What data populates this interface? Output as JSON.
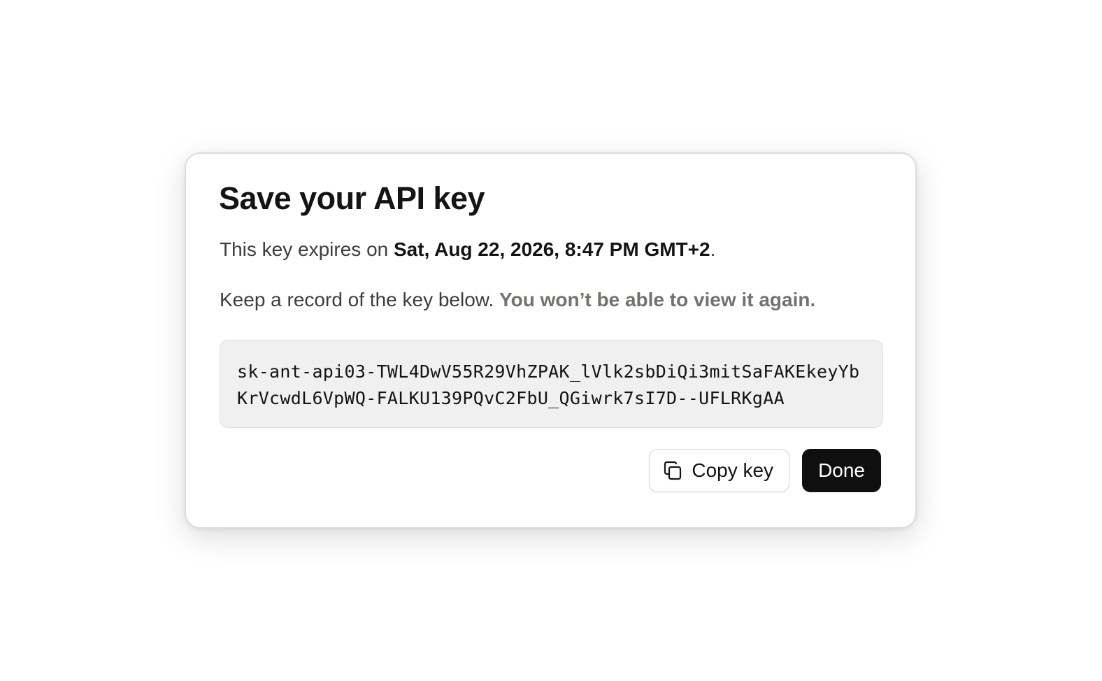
{
  "dialog": {
    "title": "Save your API key",
    "expires_prefix": "This key expires on ",
    "expires_date": "Sat, Aug 22, 2026, 8:47 PM GMT+2",
    "expires_suffix": ".",
    "record_text": "Keep a record of the key below. ",
    "record_warning": "You won’t be able to view it again.",
    "api_key": "sk-ant-api03-TWL4DwV55R29VhZPAK_lVlk2sbDiQi3mitSaFAKEkeyYbKrVcwdL6VpWQ-FALKU139PQvC2FbU_QGiwrk7sI7D--UFLRKgAA",
    "copy_button_label": "Copy key",
    "copy_button_icon": "copy-icon",
    "done_button_label": "Done"
  },
  "colors": {
    "primary_button_bg": "#0f0f0f",
    "key_box_bg": "#f0f0f0",
    "warning_text": "#73726c"
  }
}
